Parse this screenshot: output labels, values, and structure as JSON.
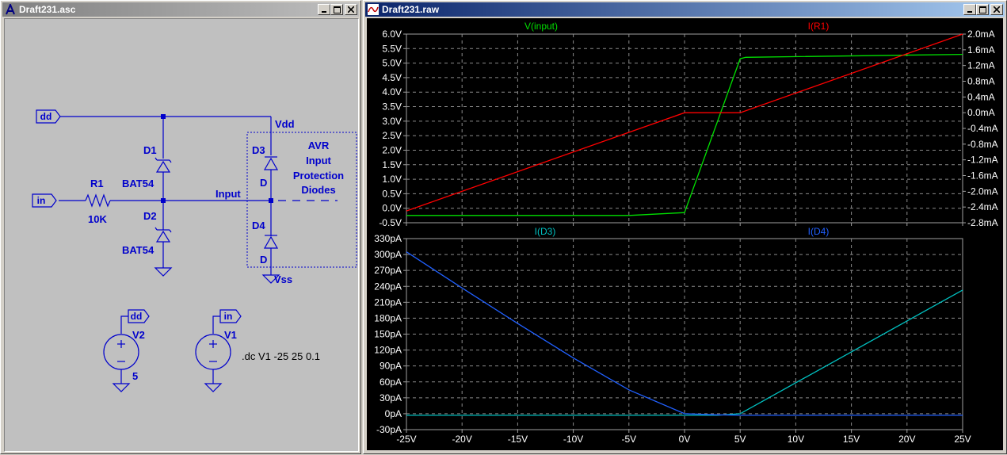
{
  "schematic_window": {
    "title": "Draft231.asc",
    "labels": {
      "port_dd": "dd",
      "port_in": "in",
      "port_dd2": "dd",
      "port_in2": "in",
      "vdd": "Vdd",
      "vss": "Vss",
      "d1": "D1",
      "d1_model": "BAT54",
      "d2": "D2",
      "d2_model": "BAT54",
      "d3": "D3",
      "d3_model": "D",
      "d4": "D4",
      "d4_model": "D",
      "r1": "R1",
      "r1_value": "10K",
      "input_net": "Input",
      "note_line1": "AVR",
      "note_line2": "Input",
      "note_line3": "Protection",
      "note_line4": "Diodes",
      "v2": "V2",
      "v2_value": "5",
      "v1": "V1",
      "directive": ".dc V1 -25 25 0.1"
    }
  },
  "plot_window": {
    "title": "Draft231.raw"
  },
  "chart_data": [
    {
      "type": "line",
      "x_unit": "V",
      "xlim": [
        -25,
        25
      ],
      "x_ticks": [
        "-25V",
        "-20V",
        "-15V",
        "-10V",
        "-5V",
        "0V",
        "5V",
        "10V",
        "15V",
        "20V",
        "25V"
      ],
      "y_left_ticks": [
        "6.0V",
        "5.5V",
        "5.0V",
        "4.5V",
        "4.0V",
        "3.5V",
        "3.0V",
        "2.5V",
        "2.0V",
        "1.5V",
        "1.0V",
        "0.5V",
        "0.0V",
        "-0.5V"
      ],
      "y_right_ticks": [
        "2.0mA",
        "1.6mA",
        "1.2mA",
        "0.8mA",
        "0.4mA",
        "0.0mA",
        "-0.4mA",
        "-0.8mA",
        "-1.2mA",
        "-1.6mA",
        "-2.0mA",
        "-2.4mA",
        "-2.8mA"
      ],
      "ylim_left": [
        -0.5,
        6.0
      ],
      "ylim_right": [
        -2.8,
        2.0
      ],
      "grid": true,
      "series": [
        {
          "name": "V(input)",
          "axis": "left",
          "color": "#00e000",
          "x": [
            -25,
            -5,
            0,
            5,
            5.5,
            25
          ],
          "y": [
            -0.25,
            -0.25,
            -0.15,
            5.15,
            5.2,
            5.3
          ]
        },
        {
          "name": "I(R1)",
          "axis": "right",
          "color": "#ff0000",
          "x": [
            -25,
            0,
            5,
            25
          ],
          "y": [
            -2.5,
            0.0,
            0.0,
            2.0
          ]
        }
      ]
    },
    {
      "type": "line",
      "x_unit": "V",
      "xlim": [
        -25,
        25
      ],
      "x_ticks": [
        "-25V",
        "-20V",
        "-15V",
        "-10V",
        "-5V",
        "0V",
        "5V",
        "10V",
        "15V",
        "20V",
        "25V"
      ],
      "y_ticks": [
        "330pA",
        "300pA",
        "270pA",
        "240pA",
        "210pA",
        "180pA",
        "150pA",
        "120pA",
        "90pA",
        "60pA",
        "30pA",
        "0pA",
        "-30pA"
      ],
      "ylim": [
        -30,
        330
      ],
      "grid": true,
      "series": [
        {
          "name": "I(D3)",
          "color": "#00c0c0",
          "x": [
            -25,
            0,
            3,
            5,
            25
          ],
          "y": [
            -3,
            -3,
            -3,
            0,
            233
          ]
        },
        {
          "name": "I(D4)",
          "color": "#2060ff",
          "x": [
            -25,
            -20,
            -15,
            -10,
            -5,
            0,
            3,
            5,
            25
          ],
          "y": [
            305,
            237,
            170,
            105,
            45,
            0,
            -2,
            -3,
            -3
          ]
        }
      ]
    }
  ]
}
